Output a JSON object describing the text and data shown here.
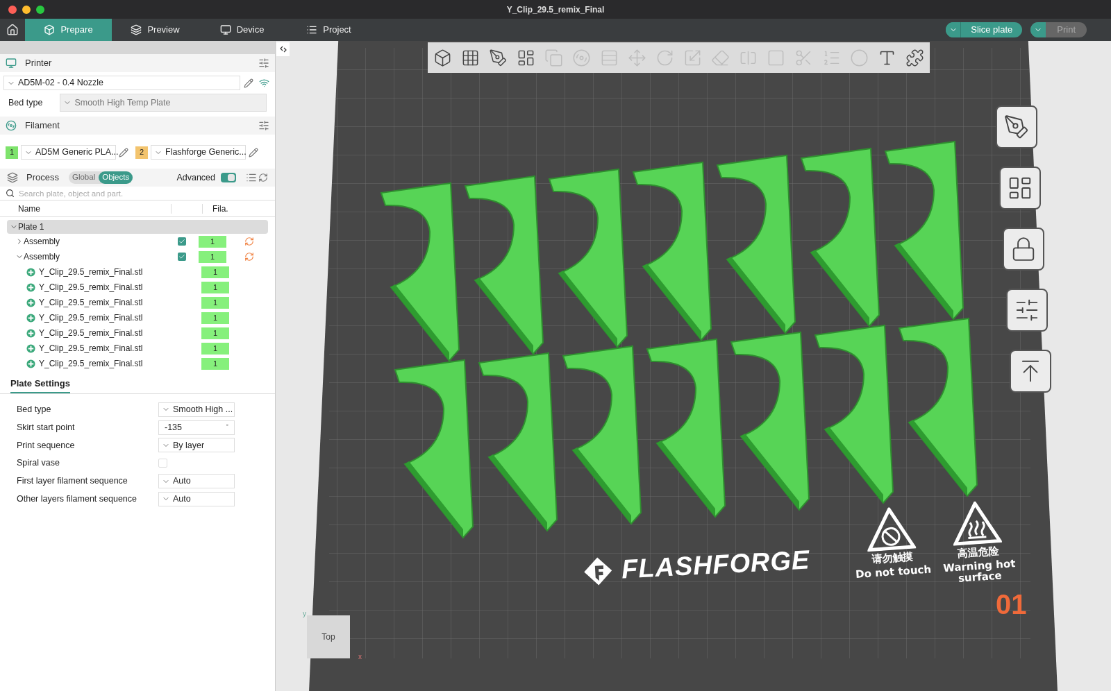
{
  "window": {
    "title": "Y_Clip_29.5_remix_Final"
  },
  "nav": {
    "tabs": [
      {
        "label": "Prepare",
        "selected": true
      },
      {
        "label": "Preview",
        "selected": false
      },
      {
        "label": "Device",
        "selected": false
      },
      {
        "label": "Project",
        "selected": false
      }
    ],
    "slice": {
      "label": "Slice plate",
      "disabled": false
    },
    "print": {
      "label": "Print",
      "disabled": true
    }
  },
  "printer": {
    "title": "Printer",
    "preset": "AD5M-02 - 0.4 Nozzle",
    "bed_type_label": "Bed type",
    "bed_type_value": "Smooth High Temp Plate"
  },
  "filament": {
    "title": "Filament",
    "items": [
      {
        "index": "1",
        "color": "#7ee36c",
        "name": "AD5M Generic PLA..."
      },
      {
        "index": "2",
        "color": "#f3c46e",
        "name": "Flashforge Generic..."
      }
    ]
  },
  "process": {
    "title": "Process",
    "modes": [
      {
        "label": "Global",
        "selected": false
      },
      {
        "label": "Objects",
        "selected": true
      }
    ],
    "advanced_label": "Advanced",
    "advanced_on": true,
    "search_placeholder": "Search plate, object and part."
  },
  "objects": {
    "columns": [
      "Name",
      "Fila."
    ],
    "tree": [
      {
        "label": "Plate 1",
        "expanded": true,
        "children": [
          {
            "label": "Assembly",
            "expanded": false,
            "checked": true,
            "filament": "1"
          },
          {
            "label": "Assembly",
            "expanded": true,
            "checked": true,
            "filament": "1",
            "children": [
              {
                "label": "Y_Clip_29.5_remix_Final.stl",
                "filament": "1"
              },
              {
                "label": "Y_Clip_29.5_remix_Final.stl",
                "filament": "1"
              },
              {
                "label": "Y_Clip_29.5_remix_Final.stl",
                "filament": "1"
              },
              {
                "label": "Y_Clip_29.5_remix_Final.stl",
                "filament": "1"
              },
              {
                "label": "Y_Clip_29.5_remix_Final.stl",
                "filament": "1"
              },
              {
                "label": "Y_Clip_29.5_remix_Final.stl",
                "filament": "1"
              },
              {
                "label": "Y_Clip_29.5_remix_Final.stl",
                "filament": "1"
              }
            ]
          }
        ]
      }
    ]
  },
  "plate_settings": {
    "title": "Plate Settings",
    "rows": [
      {
        "label": "Bed type",
        "kind": "dropdown",
        "value": "Smooth High ..."
      },
      {
        "label": "Skirt start point",
        "kind": "number",
        "value": "-135",
        "unit": "°"
      },
      {
        "label": "Print sequence",
        "kind": "dropdown",
        "value": "By layer"
      },
      {
        "label": "Spiral vase",
        "kind": "checkbox",
        "checked": false
      },
      {
        "label": "First layer filament sequence",
        "kind": "dropdown",
        "value": "Auto"
      },
      {
        "label": "Other layers filament sequence",
        "kind": "dropdown",
        "value": "Auto"
      }
    ]
  },
  "viewport": {
    "brand": "FLASHFORGE",
    "warnings": [
      {
        "cn": "请勿触摸",
        "en": [
          "Do not touch"
        ]
      },
      {
        "cn": "高温危险",
        "en": [
          "Warning hot",
          "surface"
        ]
      }
    ],
    "plate_number": "01",
    "view_cube": "Top",
    "axes": [
      "x",
      "y"
    ]
  }
}
